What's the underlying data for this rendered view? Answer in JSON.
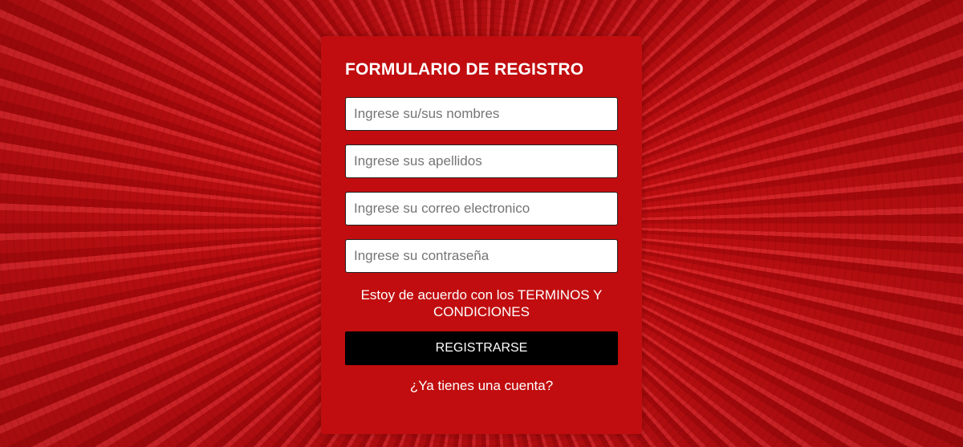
{
  "form": {
    "title": "FORMULARIO DE REGISTRO",
    "fields": [
      {
        "placeholder": "Ingrese su/sus nombres",
        "value": ""
      },
      {
        "placeholder": "Ingrese sus apellidos",
        "value": ""
      },
      {
        "placeholder": "Ingrese su correo electronico",
        "value": ""
      },
      {
        "placeholder": "Ingrese su contraseña",
        "value": ""
      }
    ],
    "terms_text": "Estoy de acuerdo con los TERMINOS Y CONDICIONES",
    "submit_label": "REGISTRARSE",
    "login_link": "¿Ya tienes una cuenta?"
  },
  "colors": {
    "card_background": "#c10d0f",
    "page_background": "#c30f12",
    "button_background": "#000000",
    "text": "#ffffff"
  }
}
